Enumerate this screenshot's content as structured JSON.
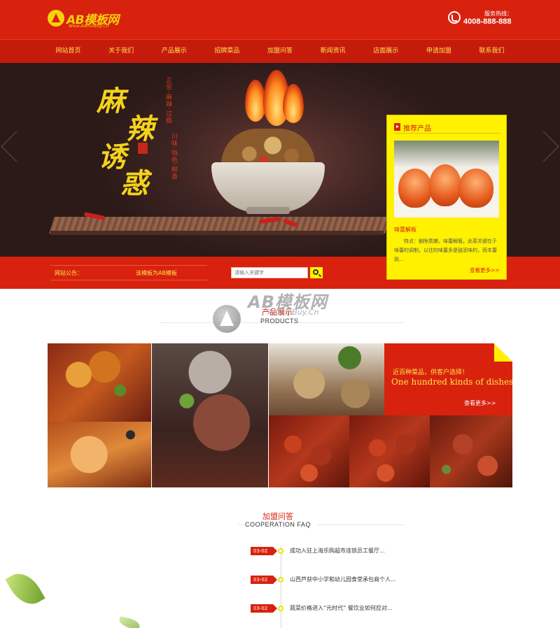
{
  "header": {
    "logo_text": "AB模板网",
    "logo_sub": "Www.AdminBuy.Cn",
    "hotline_label": "服务热线：",
    "hotline_number": "4008-888-888"
  },
  "nav": {
    "items": [
      "网站首页",
      "关于我们",
      "产品展示",
      "招牌菜品",
      "加盟问答",
      "新闻资讯",
      "店面展示",
      "申请加盟",
      "联系我们"
    ]
  },
  "banner": {
    "slogan": [
      "麻",
      "辣",
      "诱",
      "惑"
    ],
    "vertical_left": "正宗·麻辣·过瘾",
    "vertical_right": "川味·特色·鲜香"
  },
  "recommend": {
    "title": "推荐产品",
    "product_name": "味蕾解瓶",
    "description": "特点：删除质嫩，味蕾解瓶。此菜关键在于味蕾的调制，以往的味蕾多是鼓泥味的，而本蕾则...",
    "more": "查看更多>>"
  },
  "notice": {
    "label": "网站公告：",
    "text": "该模板为AB模板"
  },
  "search": {
    "placeholder": "请输入关键字"
  },
  "products_section": {
    "title_cn": "产品展示",
    "title_en": "PRODUCTS",
    "watermark_text": "AB模板网",
    "watermark_sub": "AdminBuy.Cn"
  },
  "dishes_panel": {
    "title_cn": "近百种菜品，供客户选择！",
    "title_en": "One hundred kinds of dishes",
    "more": "查看更多>>"
  },
  "faq_section": {
    "title_cn": "加盟问答",
    "title_en": "COOPERATION FAQ",
    "items": [
      {
        "date": "03-02",
        "text": "成功入驻上海乐购超市连锁员工餐厅..."
      },
      {
        "date": "03-02",
        "text": "山西芦获中小学和幼儿园食堂承包商个人..."
      },
      {
        "date": "03-02",
        "text": "蔬菜价格进入“元时代” 餐饮业如何应对..."
      }
    ]
  },
  "colors": {
    "brand_red": "#d8220e",
    "accent_yellow": "#fff100",
    "nav_text": "#ffe24a"
  }
}
